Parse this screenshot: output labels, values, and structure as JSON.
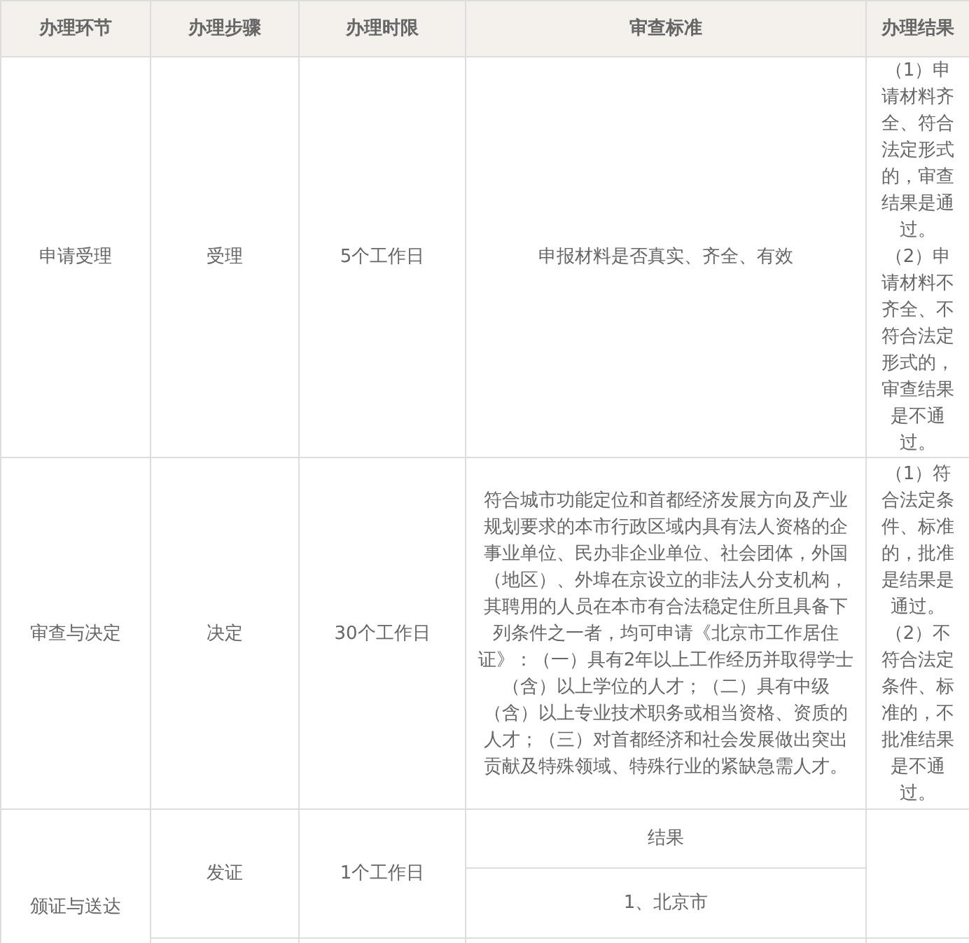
{
  "table": {
    "columns": [
      "办理环节",
      "办理步骤",
      "办理时限",
      "审查标准",
      "办理结果"
    ],
    "rows": [
      {
        "stage": "申请受理",
        "step": "受理",
        "time_limit": "5个工作日",
        "standard": "申报材料是否真实、齐全、有效",
        "result": "（1）申请材料齐全、符合法定形式的，审查结果是通过。（2）申请材料不齐全、不符合法定形式的，审查结果是不通过。"
      },
      {
        "stage": "审查与决定",
        "step": "决定",
        "time_limit": "30个工作日",
        "standard": "符合城市功能定位和首都经济发展方向及产业规划要求的本市行政区域内具有法人资格的企事业单位、民办非企业单位、社会团体，外国（地区）、外埠在京设立的非法人分支机构，其聘用的人员在本市有合法稳定住所且具备下列条件之一者，均可申请《北京市工作居住证》：（一）具有2年以上工作经历并取得学士（含）以上学位的人才；（二）具有中级（含）以上专业技术职务或相当资格、资质的人才；（三）对首都经济和社会发展做出突出贡献及特殊领域、特殊行业的紧缺急需人才。",
        "result": "（1）符合法定条件、标准的，批准是结果是通过。（2）不符合法定条件、标准的，不批准结果是不通过。"
      },
      {
        "stage": "颁证与送达",
        "step": "发证",
        "time_limit": "1个工作日",
        "standard_parts": [
          "结果",
          "1、北京市"
        ]
      }
    ]
  }
}
